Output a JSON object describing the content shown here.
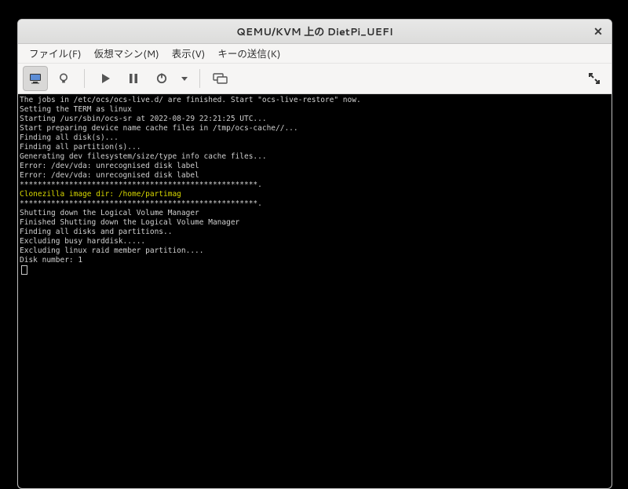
{
  "window": {
    "title": "QEMU/KVM 上の DietPi_UEFI",
    "close_glyph": "✕"
  },
  "menu": {
    "file": "ファイル(F)",
    "vm": "仮想マシン(M)",
    "view": "表示(V)",
    "sendkey": "キーの送信(K)"
  },
  "toolbar": {
    "console": "console-icon",
    "details": "details-icon",
    "run": "run-icon",
    "pause": "pause-icon",
    "power": "power-icon",
    "snapshot": "snapshot-icon",
    "fullscreen": "fullscreen-icon"
  },
  "terminal": {
    "lines": [
      "The jobs in /etc/ocs/ocs-live.d/ are finished. Start \"ocs-live-restore\" now.",
      "Setting the TERM as linux",
      "Starting /usr/sbin/ocs-sr at 2022-08-29 22:21:25 UTC...",
      "Start preparing device name cache files in /tmp/ocs-cache//...",
      "Finding all disk(s)...",
      "Finding all partition(s)...",
      "Generating dev filesystem/size/type info cache files...",
      "Error: /dev/vda: unrecognised disk label",
      "Error: /dev/vda: unrecognised disk label",
      "*****************************************************.",
      "Clonezilla image dir: /home/partimag",
      "*****************************************************.",
      "Shutting down the Logical Volume Manager",
      "Finished Shutting down the Logical Volume Manager",
      "Finding all disks and partitions..",
      "Excluding busy harddisk.....",
      "Excluding linux raid member partition....",
      "Disk number: 1"
    ],
    "highlight_index": 10
  }
}
